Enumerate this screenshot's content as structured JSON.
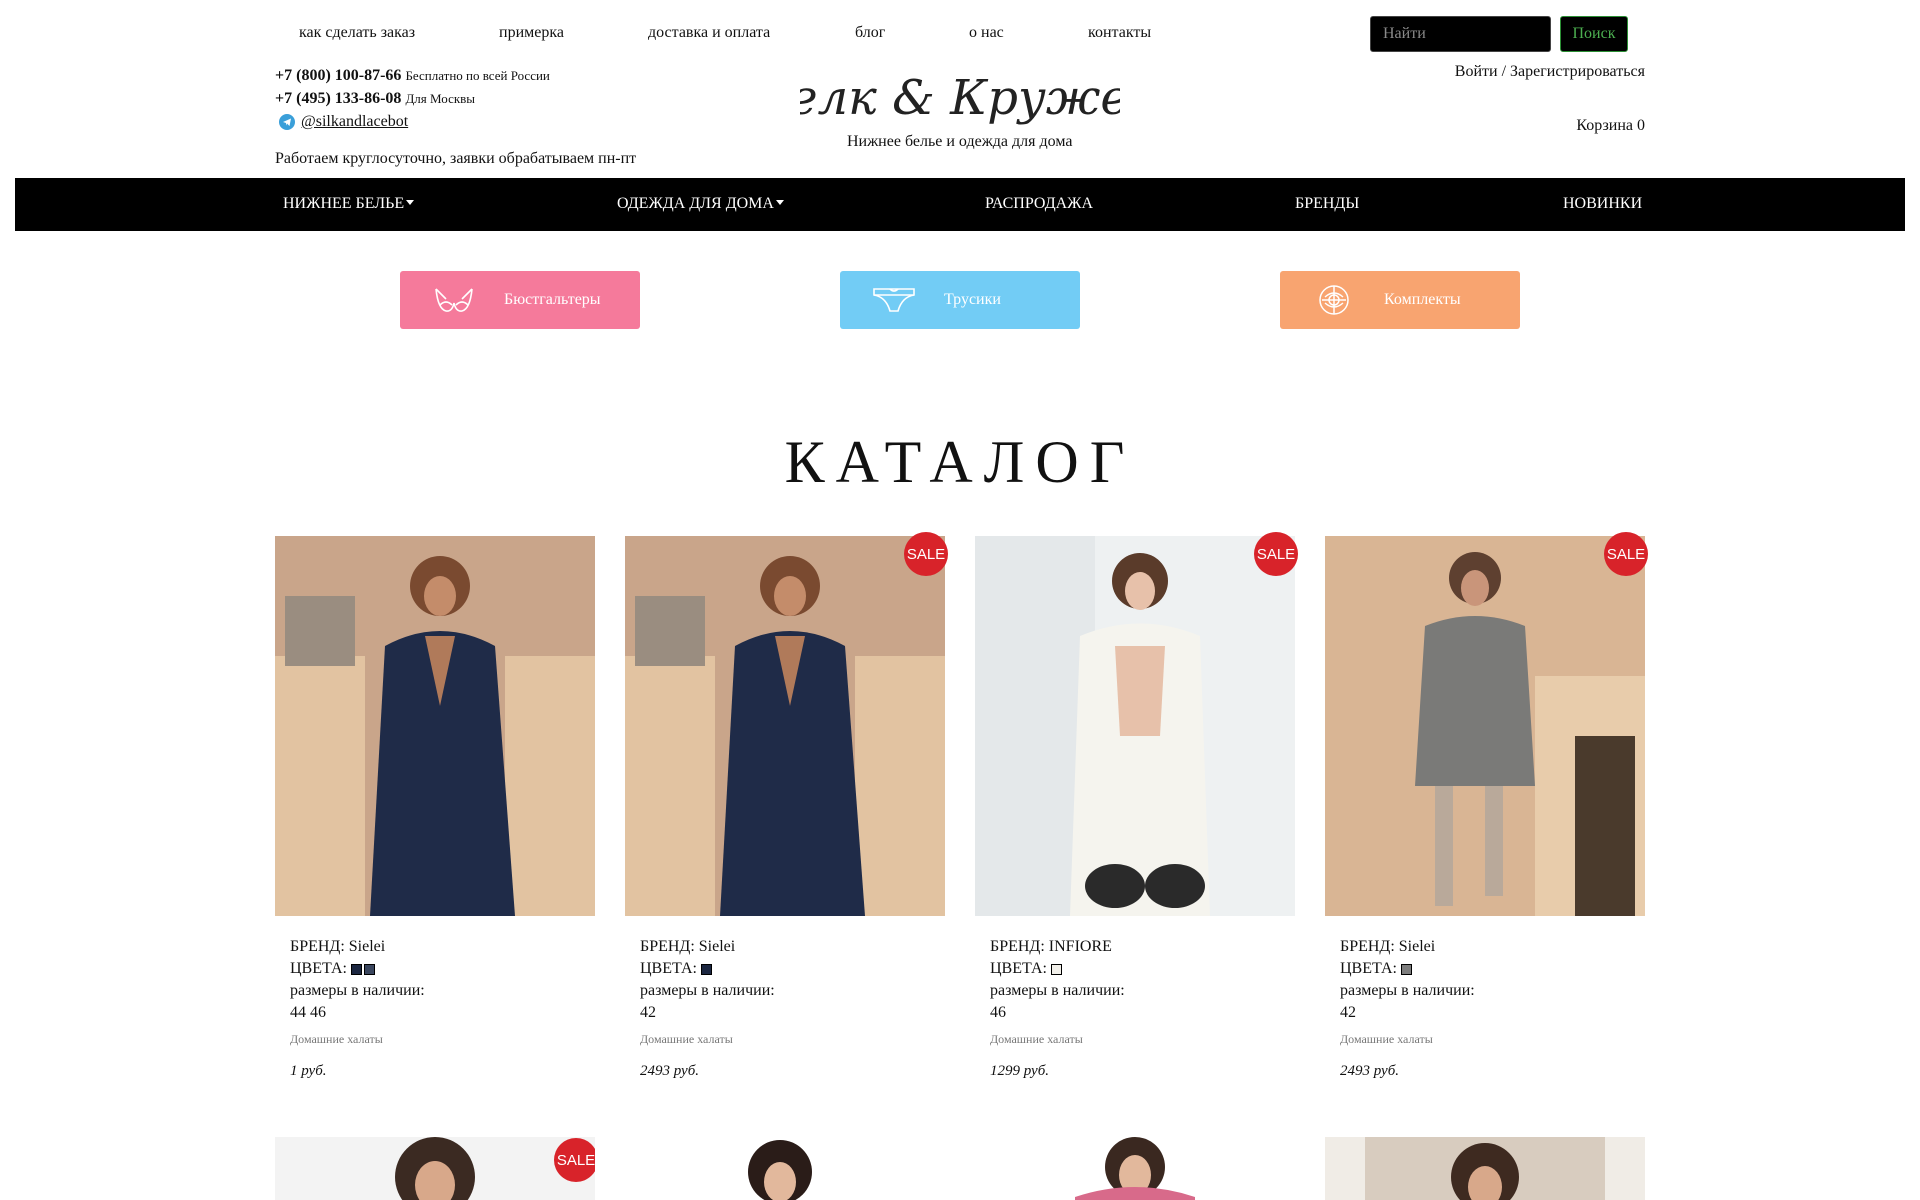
{
  "topnav": {
    "links": [
      "как сделать заказ",
      "примерка",
      "доставка и оплата",
      "блог",
      "о нас",
      "контакты"
    ],
    "search_placeholder": "Найти",
    "search_button": "Поиск",
    "login": "Войти / Зарегистрироваться",
    "cart": "Корзина 0"
  },
  "contacts": {
    "phone1": "+7 (800) 100-87-66",
    "phone1_note": "Бесплатно по всей России",
    "phone2": "+7 (495) 133-86-08",
    "phone2_note": "Для Москвы",
    "telegram": "@silkandlacebot",
    "hours": "Работаем круглосуточно, заявки обрабатываем пн-пт"
  },
  "logo": {
    "text": "Шелк & Кружево",
    "tagline": "Нижнее белье и одежда для дома"
  },
  "categories": [
    "НИЖНЕЕ БЕЛЬЕ",
    "ОДЕЖДА ДЛЯ ДОМА",
    "РАСПРОДАЖА",
    "БРЕНДЫ",
    "НОВИНКИ"
  ],
  "quick": [
    {
      "label": "Бюстгальтеры",
      "color": "#f57a9b",
      "icon": "bra-icon"
    },
    {
      "label": "Трусики",
      "color": "#72ccf5",
      "icon": "panties-icon"
    },
    {
      "label": "Комплекты",
      "color": "#f8a470",
      "icon": "lingerie-set-icon"
    }
  ],
  "catalog_title": "КАТАЛОГ",
  "sale_badge": "SALE",
  "labels": {
    "brand": "БРЕНД:",
    "colors": "ЦВЕТА:",
    "sizes": "размеры в наличии:"
  },
  "products": [
    {
      "brand": "Sielei",
      "colors": [
        "#1b2640",
        "#3a465e"
      ],
      "sizes": "44  46",
      "type": "Домашние халаты",
      "price": "1 руб.",
      "sale": false
    },
    {
      "brand": "Sielei",
      "colors": [
        "#1b2640"
      ],
      "sizes": "42",
      "type": "Домашние халаты",
      "price": "2493 руб.",
      "sale": true
    },
    {
      "brand": "INFIORE",
      "colors": [
        "#f2f0ea"
      ],
      "sizes": "46",
      "type": "Домашние халаты",
      "price": "1299 руб.",
      "sale": true
    },
    {
      "brand": "Sielei",
      "colors": [
        "#7d7d7d"
      ],
      "sizes": "42",
      "type": "Домашние халаты",
      "price": "2493 руб.",
      "sale": true
    }
  ],
  "accent": {
    "sale_red": "#d8232a",
    "search_green": "#4caf50"
  }
}
